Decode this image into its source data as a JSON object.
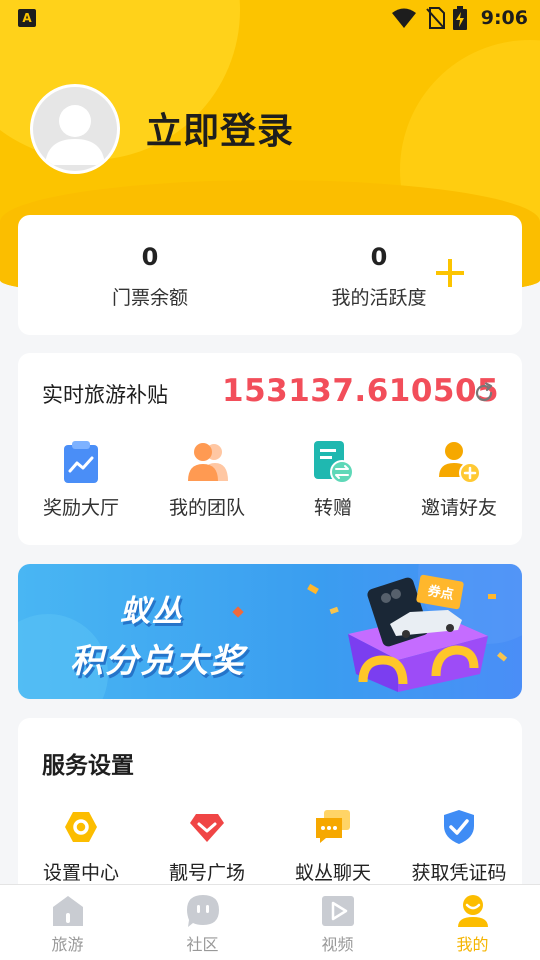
{
  "status_bar": {
    "app_icon_letter": "A",
    "time": "9:06",
    "icons": [
      "wifi-icon",
      "no-sim-icon",
      "battery-charging-icon"
    ]
  },
  "profile": {
    "login_label": "立即登录",
    "avatar_icon": "default-user-avatar"
  },
  "stats": {
    "ticket_balance": {
      "value": "0",
      "label": "门票余额"
    },
    "activity": {
      "value": "0",
      "label": "我的活跃度"
    },
    "add_icon": "plus-icon",
    "accent_color": "#fcc400"
  },
  "subsidy": {
    "label": "实时旅游补贴",
    "value": "153137.610505",
    "value_color": "#f24e5a",
    "refresh_icon": "refresh-icon",
    "items": [
      {
        "label": "奖励大厅",
        "icon": "reward-hall-icon"
      },
      {
        "label": "我的团队",
        "icon": "team-icon"
      },
      {
        "label": "转赠",
        "icon": "transfer-icon"
      },
      {
        "label": "邀请好友",
        "icon": "invite-friend-icon"
      }
    ]
  },
  "banner": {
    "line1": "蚁丛",
    "line2": "积分兑大奖",
    "badge": "券点"
  },
  "service": {
    "title": "服务设置",
    "items": [
      {
        "label": "设置中心",
        "icon": "settings-icon"
      },
      {
        "label": "靓号广场",
        "icon": "diamond-icon"
      },
      {
        "label": "蚁丛聊天",
        "icon": "chat-icon"
      },
      {
        "label": "获取凭证码",
        "icon": "shield-check-icon"
      }
    ]
  },
  "bottom_nav": {
    "active_color": "#f5b400",
    "items": [
      {
        "label": "旅游",
        "icon": "home-icon",
        "active": false
      },
      {
        "label": "社区",
        "icon": "community-icon",
        "active": false
      },
      {
        "label": "视频",
        "icon": "video-icon",
        "active": false
      },
      {
        "label": "我的",
        "icon": "profile-icon",
        "active": true
      }
    ]
  }
}
